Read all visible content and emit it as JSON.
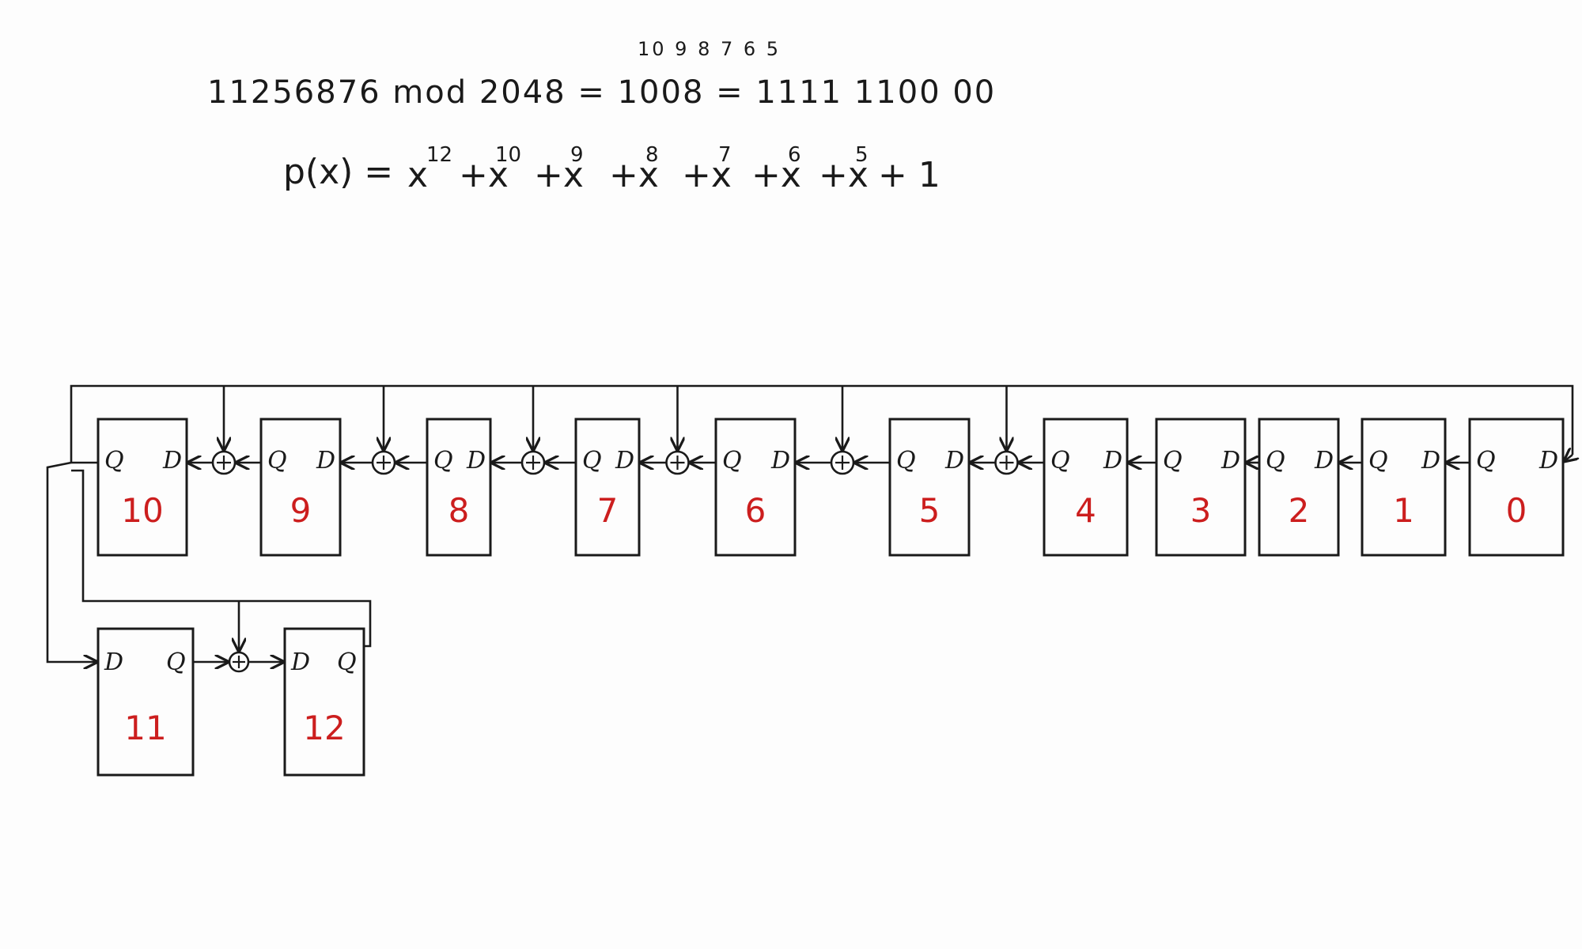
{
  "equation_line1": "11256876 mod 2048 = 1008 = 1111 1100 00",
  "exponent_labels": "10 9 8 7 6 5",
  "polynomial": {
    "lhs": "p(x) =",
    "terms": [
      {
        "base": "x",
        "exp": "12"
      },
      {
        "base": "+x",
        "exp": "10"
      },
      {
        "base": "+x",
        "exp": "9"
      },
      {
        "base": "+x",
        "exp": "8"
      },
      {
        "base": "+x",
        "exp": "7"
      },
      {
        "base": "+x",
        "exp": "6"
      },
      {
        "base": "+x",
        "exp": "5"
      },
      {
        "base": "+ 1",
        "exp": ""
      }
    ]
  },
  "pins": {
    "q": "Q",
    "d": "D"
  },
  "registers": [
    "10",
    "9",
    "8",
    "7",
    "6",
    "5",
    "4",
    "3",
    "2",
    "1",
    "0"
  ],
  "bottom_registers": [
    "11",
    "12"
  ],
  "xor_after_registers": [
    "10",
    "9",
    "8",
    "7",
    "6",
    "5"
  ],
  "xor_bottom": "11",
  "colors": {
    "ink": "#1a1a1a",
    "register_label": "#cc1e1e",
    "paper": "#fdfdfd"
  }
}
